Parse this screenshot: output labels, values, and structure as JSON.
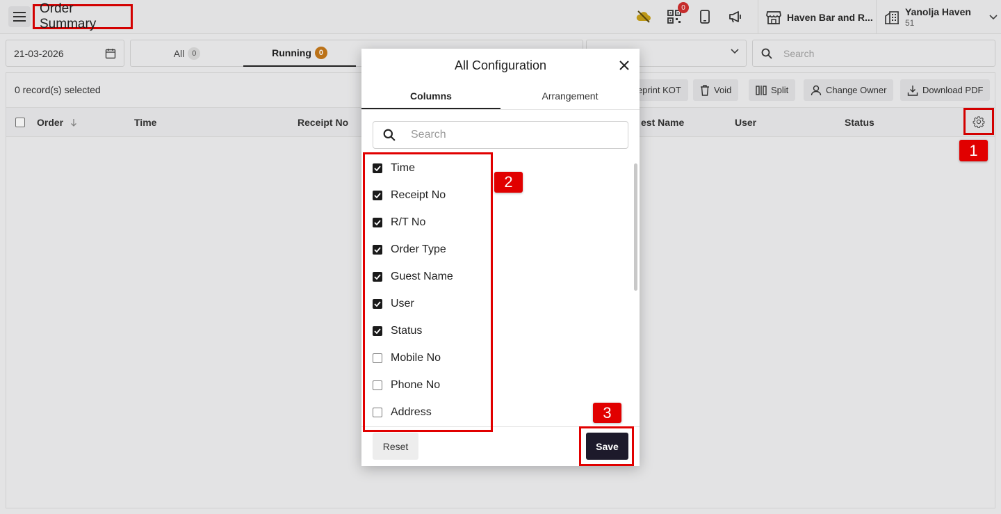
{
  "header": {
    "title": "Order Summary",
    "notification_count": "0",
    "outlet_name": "Haven Bar and R...",
    "profile_name": "Yanolja Haven",
    "profile_id": "51"
  },
  "filters": {
    "date": "21-03-2026",
    "tabs": [
      {
        "label": "All",
        "count": "0"
      },
      {
        "label": "Running",
        "count": "0"
      }
    ],
    "search_placeholder": "Search"
  },
  "toolbar": {
    "selected_text": "0 record(s) selected",
    "buttons": {
      "reprint_kot": "eprint KOT",
      "void": "Void",
      "split": "Split",
      "change_owner": "Change Owner",
      "download_pdf": "Download PDF"
    }
  },
  "table": {
    "columns": {
      "order": "Order",
      "time": "Time",
      "receipt_no": "Receipt No",
      "guest_name": "est Name",
      "user": "User",
      "status": "Status"
    }
  },
  "modal": {
    "title": "All Configuration",
    "tabs": {
      "columns": "Columns",
      "arrangement": "Arrangement"
    },
    "search_placeholder": "Search",
    "items": [
      {
        "label": "Time",
        "checked": true
      },
      {
        "label": "Receipt No",
        "checked": true
      },
      {
        "label": "R/T No",
        "checked": true
      },
      {
        "label": "Order Type",
        "checked": true
      },
      {
        "label": "Guest Name",
        "checked": true
      },
      {
        "label": "User",
        "checked": true
      },
      {
        "label": "Status",
        "checked": true
      },
      {
        "label": "Mobile No",
        "checked": false
      },
      {
        "label": "Phone No",
        "checked": false
      },
      {
        "label": "Address",
        "checked": false
      }
    ],
    "reset_label": "Reset",
    "save_label": "Save"
  },
  "annotations": {
    "one": "1",
    "two": "2",
    "three": "3"
  },
  "colors": {
    "annotation": "#e10000",
    "save_button": "#1d1a2b",
    "badge_orange": "#c77a1a",
    "badge_red": "#d32f2f"
  }
}
